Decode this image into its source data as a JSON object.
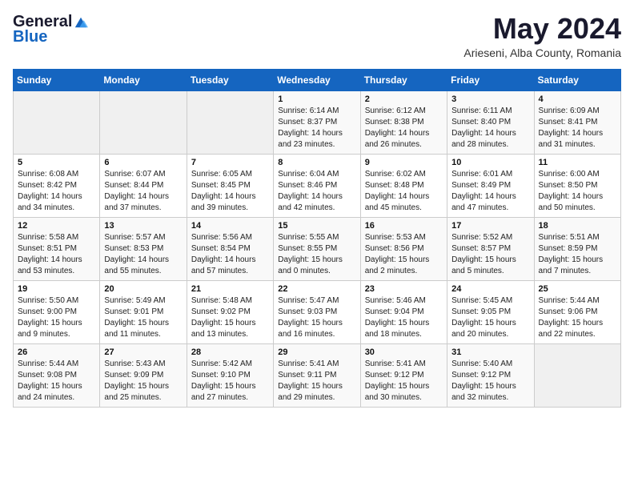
{
  "header": {
    "logo_general": "General",
    "logo_blue": "Blue",
    "month_year": "May 2024",
    "location": "Arieseni, Alba County, Romania"
  },
  "days_of_week": [
    "Sunday",
    "Monday",
    "Tuesday",
    "Wednesday",
    "Thursday",
    "Friday",
    "Saturday"
  ],
  "weeks": [
    [
      {
        "day": "",
        "sunrise": "",
        "sunset": "",
        "daylight": ""
      },
      {
        "day": "",
        "sunrise": "",
        "sunset": "",
        "daylight": ""
      },
      {
        "day": "",
        "sunrise": "",
        "sunset": "",
        "daylight": ""
      },
      {
        "day": "1",
        "sunrise": "Sunrise: 6:14 AM",
        "sunset": "Sunset: 8:37 PM",
        "daylight": "Daylight: 14 hours and 23 minutes."
      },
      {
        "day": "2",
        "sunrise": "Sunrise: 6:12 AM",
        "sunset": "Sunset: 8:38 PM",
        "daylight": "Daylight: 14 hours and 26 minutes."
      },
      {
        "day": "3",
        "sunrise": "Sunrise: 6:11 AM",
        "sunset": "Sunset: 8:40 PM",
        "daylight": "Daylight: 14 hours and 28 minutes."
      },
      {
        "day": "4",
        "sunrise": "Sunrise: 6:09 AM",
        "sunset": "Sunset: 8:41 PM",
        "daylight": "Daylight: 14 hours and 31 minutes."
      }
    ],
    [
      {
        "day": "5",
        "sunrise": "Sunrise: 6:08 AM",
        "sunset": "Sunset: 8:42 PM",
        "daylight": "Daylight: 14 hours and 34 minutes."
      },
      {
        "day": "6",
        "sunrise": "Sunrise: 6:07 AM",
        "sunset": "Sunset: 8:44 PM",
        "daylight": "Daylight: 14 hours and 37 minutes."
      },
      {
        "day": "7",
        "sunrise": "Sunrise: 6:05 AM",
        "sunset": "Sunset: 8:45 PM",
        "daylight": "Daylight: 14 hours and 39 minutes."
      },
      {
        "day": "8",
        "sunrise": "Sunrise: 6:04 AM",
        "sunset": "Sunset: 8:46 PM",
        "daylight": "Daylight: 14 hours and 42 minutes."
      },
      {
        "day": "9",
        "sunrise": "Sunrise: 6:02 AM",
        "sunset": "Sunset: 8:48 PM",
        "daylight": "Daylight: 14 hours and 45 minutes."
      },
      {
        "day": "10",
        "sunrise": "Sunrise: 6:01 AM",
        "sunset": "Sunset: 8:49 PM",
        "daylight": "Daylight: 14 hours and 47 minutes."
      },
      {
        "day": "11",
        "sunrise": "Sunrise: 6:00 AM",
        "sunset": "Sunset: 8:50 PM",
        "daylight": "Daylight: 14 hours and 50 minutes."
      }
    ],
    [
      {
        "day": "12",
        "sunrise": "Sunrise: 5:58 AM",
        "sunset": "Sunset: 8:51 PM",
        "daylight": "Daylight: 14 hours and 53 minutes."
      },
      {
        "day": "13",
        "sunrise": "Sunrise: 5:57 AM",
        "sunset": "Sunset: 8:53 PM",
        "daylight": "Daylight: 14 hours and 55 minutes."
      },
      {
        "day": "14",
        "sunrise": "Sunrise: 5:56 AM",
        "sunset": "Sunset: 8:54 PM",
        "daylight": "Daylight: 14 hours and 57 minutes."
      },
      {
        "day": "15",
        "sunrise": "Sunrise: 5:55 AM",
        "sunset": "Sunset: 8:55 PM",
        "daylight": "Daylight: 15 hours and 0 minutes."
      },
      {
        "day": "16",
        "sunrise": "Sunrise: 5:53 AM",
        "sunset": "Sunset: 8:56 PM",
        "daylight": "Daylight: 15 hours and 2 minutes."
      },
      {
        "day": "17",
        "sunrise": "Sunrise: 5:52 AM",
        "sunset": "Sunset: 8:57 PM",
        "daylight": "Daylight: 15 hours and 5 minutes."
      },
      {
        "day": "18",
        "sunrise": "Sunrise: 5:51 AM",
        "sunset": "Sunset: 8:59 PM",
        "daylight": "Daylight: 15 hours and 7 minutes."
      }
    ],
    [
      {
        "day": "19",
        "sunrise": "Sunrise: 5:50 AM",
        "sunset": "Sunset: 9:00 PM",
        "daylight": "Daylight: 15 hours and 9 minutes."
      },
      {
        "day": "20",
        "sunrise": "Sunrise: 5:49 AM",
        "sunset": "Sunset: 9:01 PM",
        "daylight": "Daylight: 15 hours and 11 minutes."
      },
      {
        "day": "21",
        "sunrise": "Sunrise: 5:48 AM",
        "sunset": "Sunset: 9:02 PM",
        "daylight": "Daylight: 15 hours and 13 minutes."
      },
      {
        "day": "22",
        "sunrise": "Sunrise: 5:47 AM",
        "sunset": "Sunset: 9:03 PM",
        "daylight": "Daylight: 15 hours and 16 minutes."
      },
      {
        "day": "23",
        "sunrise": "Sunrise: 5:46 AM",
        "sunset": "Sunset: 9:04 PM",
        "daylight": "Daylight: 15 hours and 18 minutes."
      },
      {
        "day": "24",
        "sunrise": "Sunrise: 5:45 AM",
        "sunset": "Sunset: 9:05 PM",
        "daylight": "Daylight: 15 hours and 20 minutes."
      },
      {
        "day": "25",
        "sunrise": "Sunrise: 5:44 AM",
        "sunset": "Sunset: 9:06 PM",
        "daylight": "Daylight: 15 hours and 22 minutes."
      }
    ],
    [
      {
        "day": "26",
        "sunrise": "Sunrise: 5:44 AM",
        "sunset": "Sunset: 9:08 PM",
        "daylight": "Daylight: 15 hours and 24 minutes."
      },
      {
        "day": "27",
        "sunrise": "Sunrise: 5:43 AM",
        "sunset": "Sunset: 9:09 PM",
        "daylight": "Daylight: 15 hours and 25 minutes."
      },
      {
        "day": "28",
        "sunrise": "Sunrise: 5:42 AM",
        "sunset": "Sunset: 9:10 PM",
        "daylight": "Daylight: 15 hours and 27 minutes."
      },
      {
        "day": "29",
        "sunrise": "Sunrise: 5:41 AM",
        "sunset": "Sunset: 9:11 PM",
        "daylight": "Daylight: 15 hours and 29 minutes."
      },
      {
        "day": "30",
        "sunrise": "Sunrise: 5:41 AM",
        "sunset": "Sunset: 9:12 PM",
        "daylight": "Daylight: 15 hours and 30 minutes."
      },
      {
        "day": "31",
        "sunrise": "Sunrise: 5:40 AM",
        "sunset": "Sunset: 9:12 PM",
        "daylight": "Daylight: 15 hours and 32 minutes."
      },
      {
        "day": "",
        "sunrise": "",
        "sunset": "",
        "daylight": ""
      }
    ]
  ]
}
